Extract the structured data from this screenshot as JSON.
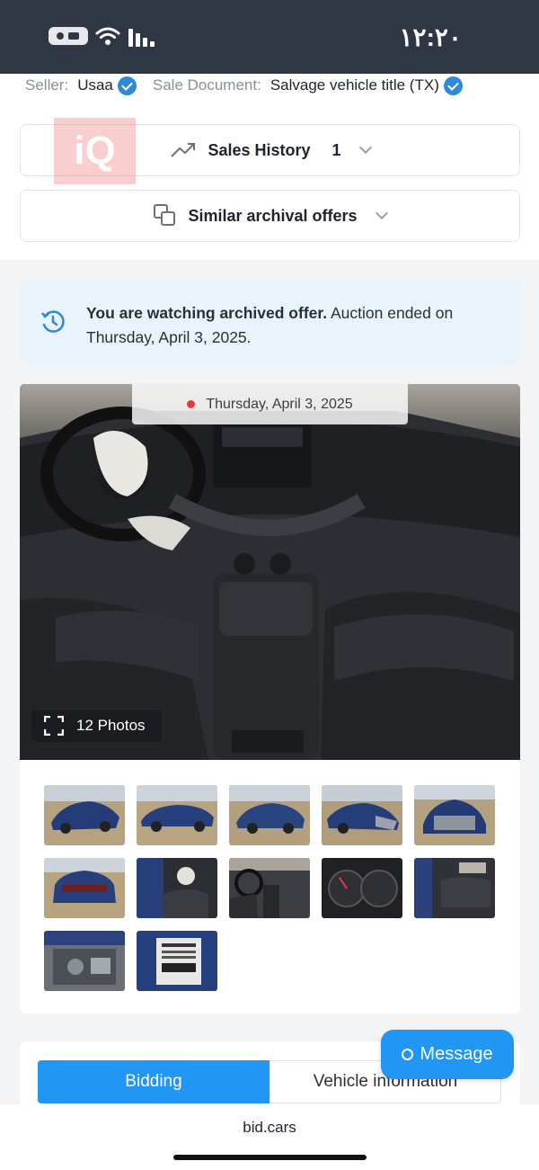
{
  "status_bar": {
    "time": "۱۲:۲۰"
  },
  "seller_info": {
    "seller_label": "Seller:",
    "seller_value": "Usaa",
    "sale_doc_label": "Sale Document:",
    "sale_doc_value": "Salvage vehicle title (TX)"
  },
  "logo": {
    "text": "iQ"
  },
  "sales_history": {
    "label": "Sales History",
    "count": "1"
  },
  "similar_offers": {
    "label": "Similar archival offers"
  },
  "notice": {
    "bold": "You are watching archived offer.",
    "text": " Auction ended on Thursday, April 3, 2025."
  },
  "gallery": {
    "date": "Thursday, April 3, 2025",
    "photos_count": "12 Photos",
    "thumbnails": [
      "front-left exterior",
      "left side",
      "rear-left",
      "front-right damage",
      "front damage",
      "rear",
      "driver interior",
      "dashboard",
      "instrument cluster",
      "rear seats",
      "engine bay",
      "vin label"
    ]
  },
  "tabs": {
    "bidding": "Bidding",
    "vehicle_info": "Vehicle information"
  },
  "message_button": {
    "label": "Message"
  },
  "browser": {
    "url": "bid.cars"
  },
  "colors": {
    "accent": "#2196f3",
    "verified": "#2e8ad8",
    "status_bar": "#2f3644",
    "notice_bg": "#e8f3fc"
  }
}
